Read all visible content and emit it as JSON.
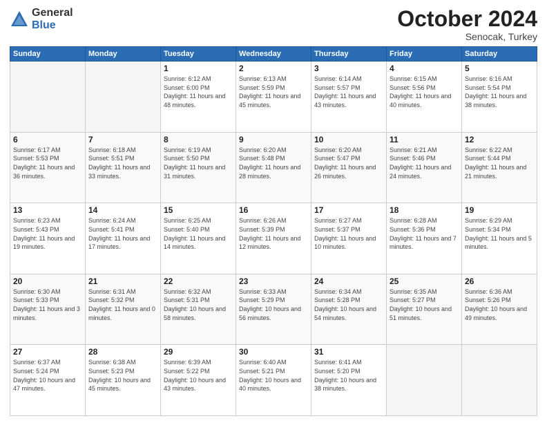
{
  "header": {
    "logo_general": "General",
    "logo_blue": "Blue",
    "month_title": "October 2024",
    "subtitle": "Senocak, Turkey"
  },
  "days_of_week": [
    "Sunday",
    "Monday",
    "Tuesday",
    "Wednesday",
    "Thursday",
    "Friday",
    "Saturday"
  ],
  "weeks": [
    [
      {
        "day": "",
        "info": ""
      },
      {
        "day": "",
        "info": ""
      },
      {
        "day": "1",
        "info": "Sunrise: 6:12 AM\nSunset: 6:00 PM\nDaylight: 11 hours and 48 minutes."
      },
      {
        "day": "2",
        "info": "Sunrise: 6:13 AM\nSunset: 5:59 PM\nDaylight: 11 hours and 45 minutes."
      },
      {
        "day": "3",
        "info": "Sunrise: 6:14 AM\nSunset: 5:57 PM\nDaylight: 11 hours and 43 minutes."
      },
      {
        "day": "4",
        "info": "Sunrise: 6:15 AM\nSunset: 5:56 PM\nDaylight: 11 hours and 40 minutes."
      },
      {
        "day": "5",
        "info": "Sunrise: 6:16 AM\nSunset: 5:54 PM\nDaylight: 11 hours and 38 minutes."
      }
    ],
    [
      {
        "day": "6",
        "info": "Sunrise: 6:17 AM\nSunset: 5:53 PM\nDaylight: 11 hours and 36 minutes."
      },
      {
        "day": "7",
        "info": "Sunrise: 6:18 AM\nSunset: 5:51 PM\nDaylight: 11 hours and 33 minutes."
      },
      {
        "day": "8",
        "info": "Sunrise: 6:19 AM\nSunset: 5:50 PM\nDaylight: 11 hours and 31 minutes."
      },
      {
        "day": "9",
        "info": "Sunrise: 6:20 AM\nSunset: 5:48 PM\nDaylight: 11 hours and 28 minutes."
      },
      {
        "day": "10",
        "info": "Sunrise: 6:20 AM\nSunset: 5:47 PM\nDaylight: 11 hours and 26 minutes."
      },
      {
        "day": "11",
        "info": "Sunrise: 6:21 AM\nSunset: 5:46 PM\nDaylight: 11 hours and 24 minutes."
      },
      {
        "day": "12",
        "info": "Sunrise: 6:22 AM\nSunset: 5:44 PM\nDaylight: 11 hours and 21 minutes."
      }
    ],
    [
      {
        "day": "13",
        "info": "Sunrise: 6:23 AM\nSunset: 5:43 PM\nDaylight: 11 hours and 19 minutes."
      },
      {
        "day": "14",
        "info": "Sunrise: 6:24 AM\nSunset: 5:41 PM\nDaylight: 11 hours and 17 minutes."
      },
      {
        "day": "15",
        "info": "Sunrise: 6:25 AM\nSunset: 5:40 PM\nDaylight: 11 hours and 14 minutes."
      },
      {
        "day": "16",
        "info": "Sunrise: 6:26 AM\nSunset: 5:39 PM\nDaylight: 11 hours and 12 minutes."
      },
      {
        "day": "17",
        "info": "Sunrise: 6:27 AM\nSunset: 5:37 PM\nDaylight: 11 hours and 10 minutes."
      },
      {
        "day": "18",
        "info": "Sunrise: 6:28 AM\nSunset: 5:36 PM\nDaylight: 11 hours and 7 minutes."
      },
      {
        "day": "19",
        "info": "Sunrise: 6:29 AM\nSunset: 5:34 PM\nDaylight: 11 hours and 5 minutes."
      }
    ],
    [
      {
        "day": "20",
        "info": "Sunrise: 6:30 AM\nSunset: 5:33 PM\nDaylight: 11 hours and 3 minutes."
      },
      {
        "day": "21",
        "info": "Sunrise: 6:31 AM\nSunset: 5:32 PM\nDaylight: 11 hours and 0 minutes."
      },
      {
        "day": "22",
        "info": "Sunrise: 6:32 AM\nSunset: 5:31 PM\nDaylight: 10 hours and 58 minutes."
      },
      {
        "day": "23",
        "info": "Sunrise: 6:33 AM\nSunset: 5:29 PM\nDaylight: 10 hours and 56 minutes."
      },
      {
        "day": "24",
        "info": "Sunrise: 6:34 AM\nSunset: 5:28 PM\nDaylight: 10 hours and 54 minutes."
      },
      {
        "day": "25",
        "info": "Sunrise: 6:35 AM\nSunset: 5:27 PM\nDaylight: 10 hours and 51 minutes."
      },
      {
        "day": "26",
        "info": "Sunrise: 6:36 AM\nSunset: 5:26 PM\nDaylight: 10 hours and 49 minutes."
      }
    ],
    [
      {
        "day": "27",
        "info": "Sunrise: 6:37 AM\nSunset: 5:24 PM\nDaylight: 10 hours and 47 minutes."
      },
      {
        "day": "28",
        "info": "Sunrise: 6:38 AM\nSunset: 5:23 PM\nDaylight: 10 hours and 45 minutes."
      },
      {
        "day": "29",
        "info": "Sunrise: 6:39 AM\nSunset: 5:22 PM\nDaylight: 10 hours and 43 minutes."
      },
      {
        "day": "30",
        "info": "Sunrise: 6:40 AM\nSunset: 5:21 PM\nDaylight: 10 hours and 40 minutes."
      },
      {
        "day": "31",
        "info": "Sunrise: 6:41 AM\nSunset: 5:20 PM\nDaylight: 10 hours and 38 minutes."
      },
      {
        "day": "",
        "info": ""
      },
      {
        "day": "",
        "info": ""
      }
    ]
  ]
}
